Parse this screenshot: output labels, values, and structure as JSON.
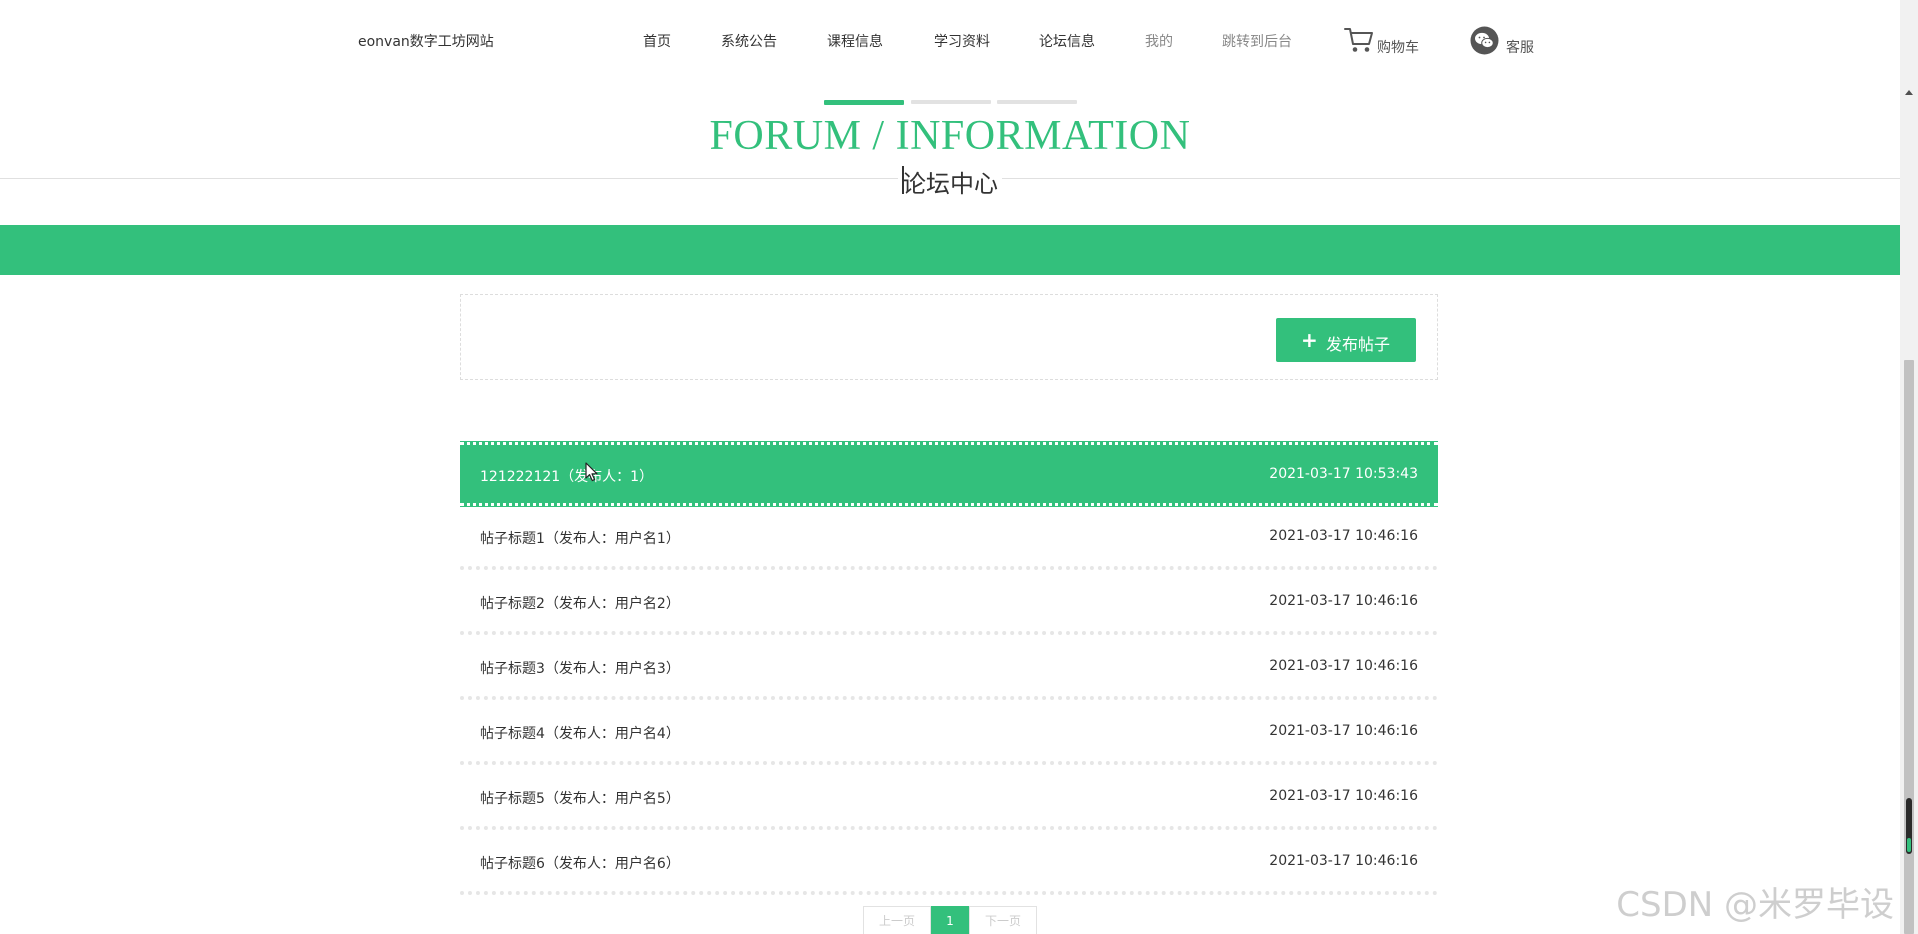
{
  "header": {
    "site_name": "eonvan数字工坊网站",
    "nav": {
      "home": "首页",
      "notice": "系统公告",
      "course": "课程信息",
      "study": "学习资料",
      "forum": "论坛信息",
      "mine": "我的",
      "admin": "跳转到后台",
      "cart": "购物车",
      "service": "客服"
    },
    "icons": {
      "cart": "shopping-cart-icon",
      "service": "wechat-icon"
    }
  },
  "section": {
    "title_en": "FORUM / INFORMATION",
    "title_cn": "论坛中心"
  },
  "publish": {
    "label": "发布帖子",
    "icon": "plus-icon"
  },
  "posts": [
    {
      "title": "121222121（发布人：1）",
      "time": "2021-03-17 10:53:43"
    },
    {
      "title": "帖子标题1（发布人：用户名1）",
      "time": "2021-03-17 10:46:16"
    },
    {
      "title": "帖子标题2（发布人：用户名2）",
      "time": "2021-03-17 10:46:16"
    },
    {
      "title": "帖子标题3（发布人：用户名3）",
      "time": "2021-03-17 10:46:16"
    },
    {
      "title": "帖子标题4（发布人：用户名4）",
      "time": "2021-03-17 10:46:16"
    },
    {
      "title": "帖子标题5（发布人：用户名5）",
      "time": "2021-03-17 10:46:16"
    },
    {
      "title": "帖子标题6（发布人：用户名6）",
      "time": "2021-03-17 10:46:16"
    }
  ],
  "pagination": {
    "prev": "上一页",
    "current": "1",
    "next": "下一页"
  },
  "watermark": "CSDN @米罗毕设",
  "colors": {
    "accent": "#33c07c",
    "text": "#333333",
    "muted": "#888888",
    "divider": "#e0e0e0"
  }
}
